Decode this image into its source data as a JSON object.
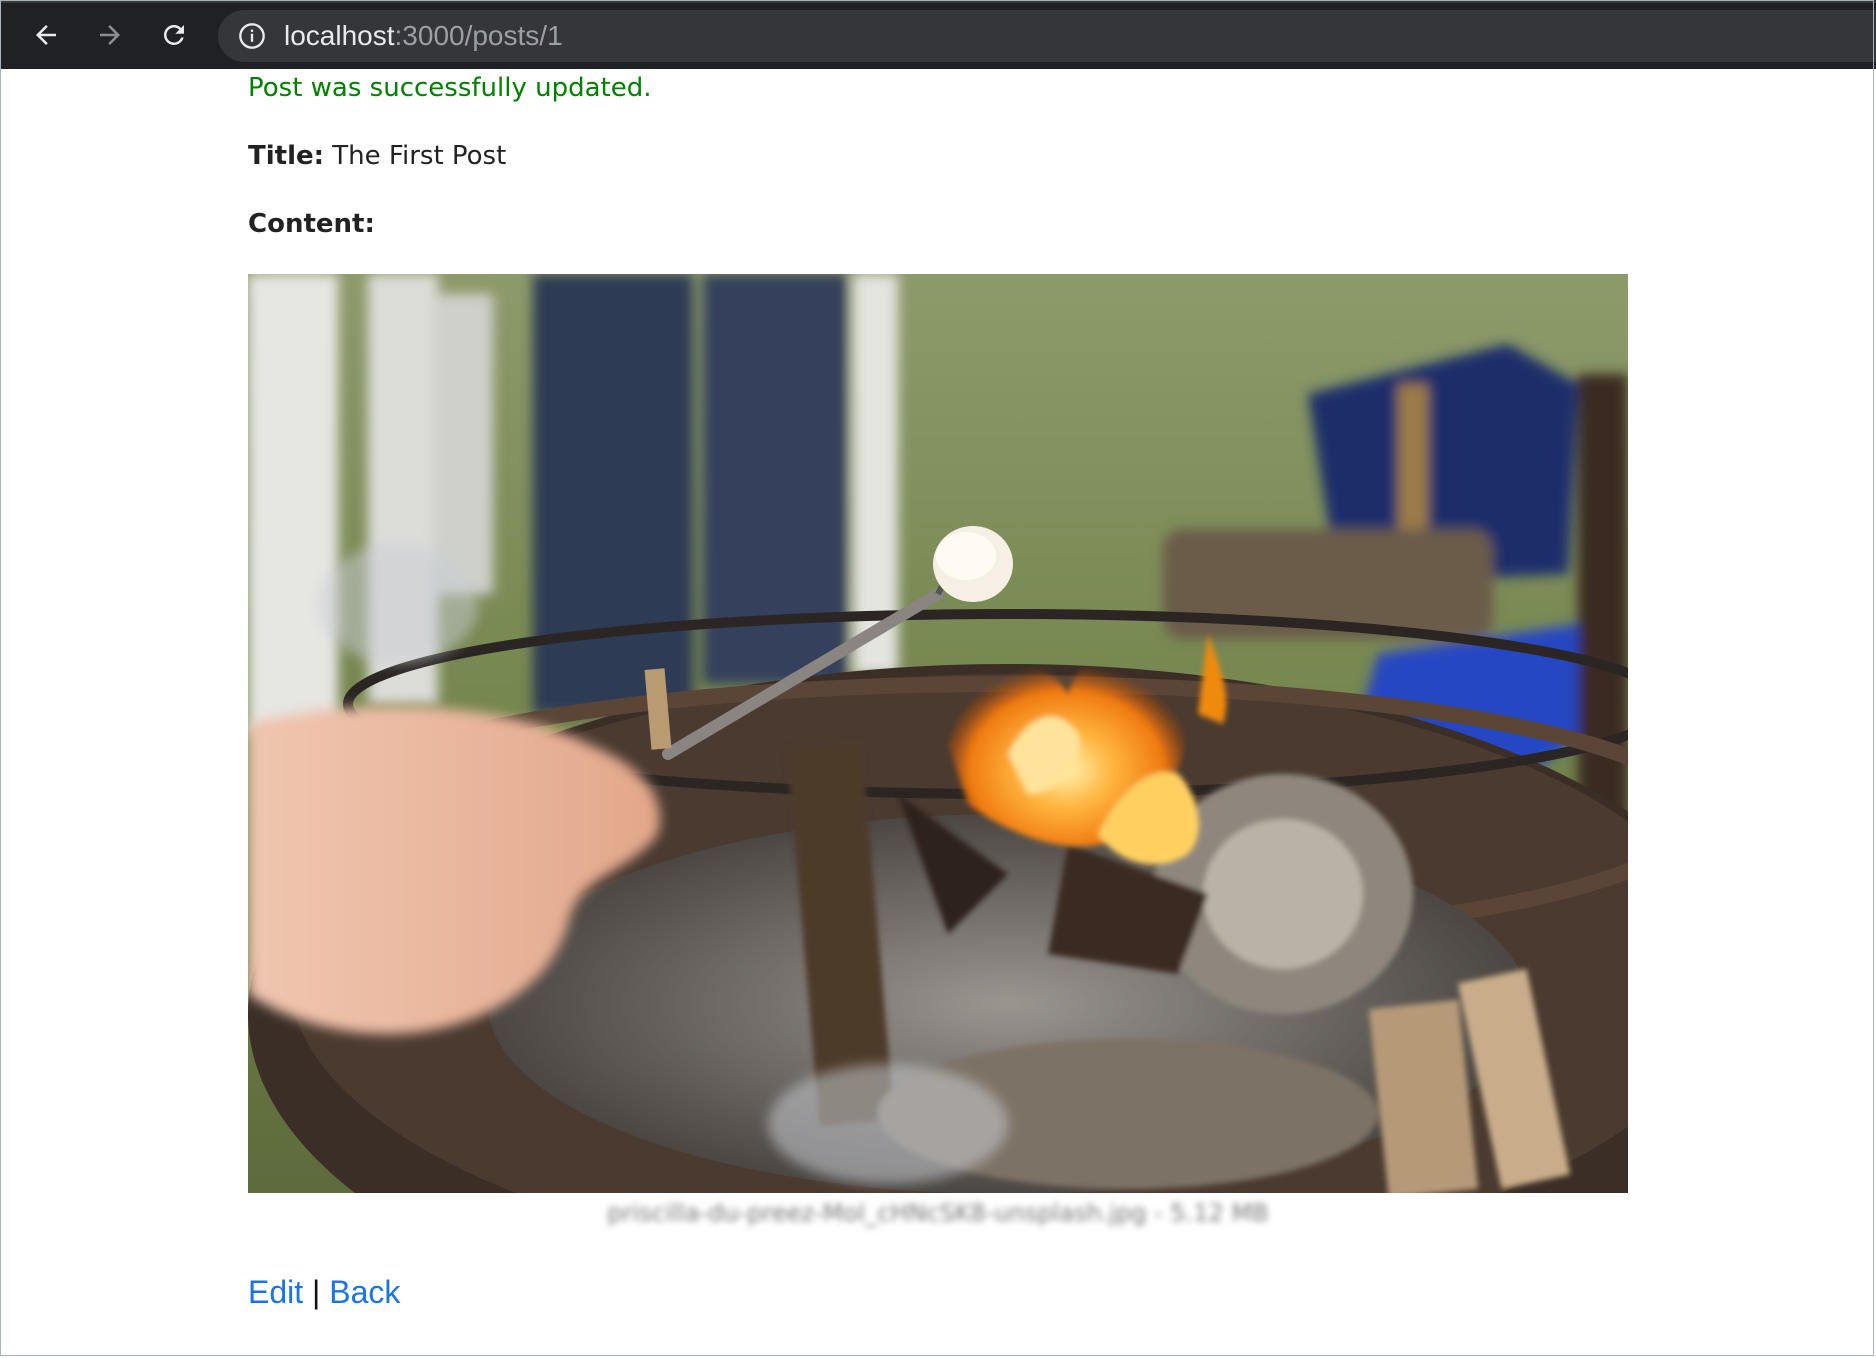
{
  "browser": {
    "url_host": "localhost",
    "url_path": ":3000/posts/1"
  },
  "page": {
    "notice": "Post was successfully updated.",
    "title_label": "Title:",
    "title_value": "The First Post",
    "content_label": "Content:",
    "attachment_caption": "priscilla-du-preez-MoI_cHNcSK8-unsplash.jpg - 5.12 MB",
    "edit_link": "Edit",
    "separator": "|",
    "back_link": "Back"
  },
  "colors": {
    "notice": "#008000",
    "link": "#1a73e8",
    "toolbar": "#202124",
    "omnibox": "#35363a"
  },
  "icons": [
    "back-arrow-icon",
    "forward-arrow-icon",
    "reload-icon",
    "info-icon"
  ]
}
